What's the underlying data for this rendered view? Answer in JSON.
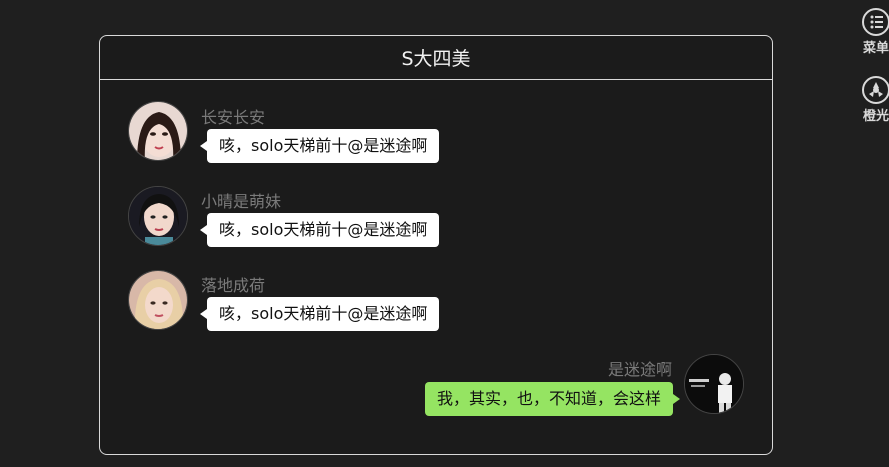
{
  "chat": {
    "title": "S大四美",
    "messages": [
      {
        "sender": "长安长安",
        "text": "咳，solo天梯前十@是迷途啊",
        "side": "left"
      },
      {
        "sender": "小晴是萌妹",
        "text": "咳，solo天梯前十@是迷途啊",
        "side": "left"
      },
      {
        "sender": "落地成荷",
        "text": "咳，solo天梯前十@是迷途啊",
        "side": "left"
      },
      {
        "sender": "是迷途啊",
        "text": "我，其实，也，不知道，会这样",
        "side": "right"
      }
    ]
  },
  "side_tools": [
    {
      "label": "菜单",
      "icon": "menu-icon"
    },
    {
      "label": "橙光",
      "icon": "orange-light-icon"
    }
  ],
  "colors": {
    "background": "#1f1f1f",
    "left_bubble": "#ffffff",
    "right_bubble": "#95e462",
    "sender_name": "#7a7a7a",
    "border": "#d9d9d9"
  }
}
